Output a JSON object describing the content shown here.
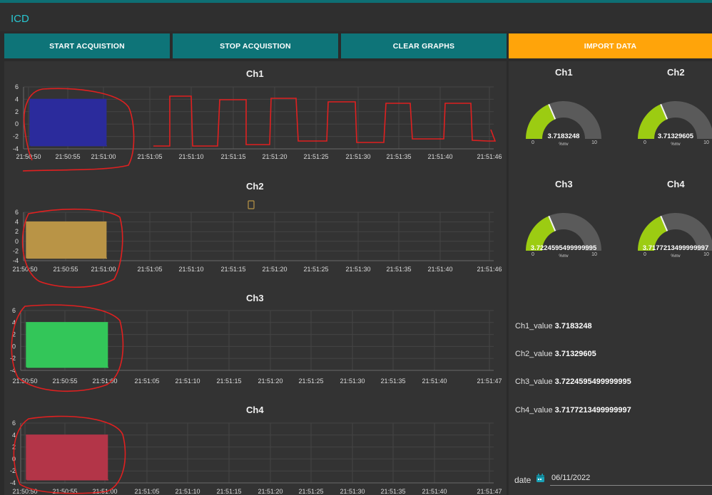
{
  "app": {
    "title": "ICD"
  },
  "toolbar": {
    "start_label": "START ACQUISTION",
    "stop_label": "STOP ACQUISTION",
    "clear_label": "CLEAR GRAPHS",
    "import_label": "IMPORT DATA"
  },
  "chart_data": [
    {
      "type": "line",
      "title": "Ch1",
      "x_ticks": [
        "21:50:50",
        "21:50:55",
        "21:51:00",
        "21:51:05",
        "21:51:10",
        "21:51:15",
        "21:51:20",
        "21:51:25",
        "21:51:30",
        "21:51:35",
        "21:51:40",
        "21:51:46"
      ],
      "y_ticks": [
        "6",
        "4",
        "2",
        "0",
        "-2",
        "-4"
      ],
      "ylim": [
        -4,
        6
      ],
      "series": [
        {
          "color": "#2b2b9c",
          "high": 4,
          "low": -3.5,
          "x_range": [
            "21:50:50",
            "21:51:00"
          ]
        }
      ]
    },
    {
      "type": "line",
      "title": "Ch2",
      "x_ticks": [
        "21:50:50",
        "21:50:55",
        "21:51:00",
        "21:51:05",
        "21:51:10",
        "21:51:15",
        "21:51:20",
        "21:51:25",
        "21:51:30",
        "21:51:35",
        "21:51:40",
        "21:51:46"
      ],
      "y_ticks": [
        "6",
        "4",
        "2",
        "0",
        "-2",
        "-4"
      ],
      "ylim": [
        -4,
        6
      ],
      "series": [
        {
          "color": "#b99446",
          "high": 4,
          "low": -3.5,
          "x_range": [
            "21:50:50",
            "21:51:00"
          ]
        }
      ]
    },
    {
      "type": "line",
      "title": "Ch3",
      "x_ticks": [
        "21:50:50",
        "21:50:55",
        "21:51:00",
        "21:51:05",
        "21:51:10",
        "21:51:15",
        "21:51:20",
        "21:51:25",
        "21:51:30",
        "21:51:35",
        "21:51:40",
        "21:51:47"
      ],
      "y_ticks": [
        "6",
        "4",
        "2",
        "0",
        "-2",
        "-4"
      ],
      "ylim": [
        -4,
        6
      ],
      "series": [
        {
          "color": "#33c659",
          "high": 4,
          "low": -3.5,
          "x_range": [
            "21:50:50",
            "21:51:00"
          ]
        }
      ]
    },
    {
      "type": "line",
      "title": "Ch4",
      "x_ticks": [
        "21:50:50",
        "21:50:55",
        "21:51:00",
        "21:51:05",
        "21:51:10",
        "21:51:15",
        "21:51:20",
        "21:51:25",
        "21:51:30",
        "21:51:35",
        "21:51:40",
        "21:51:47"
      ],
      "y_ticks": [
        "6",
        "4",
        "2",
        "0",
        "-2",
        "-4"
      ],
      "ylim": [
        -4,
        6
      ],
      "series": [
        {
          "color": "#b33548",
          "high": 4,
          "low": -3.5,
          "x_range": [
            "21:50:50",
            "21:51:00"
          ]
        }
      ]
    }
  ],
  "gauges": [
    {
      "title": "Ch1",
      "value": 3.7183248,
      "value_text": "3.7183248",
      "min": "0",
      "max": "10",
      "unit": "%mv"
    },
    {
      "title": "Ch2",
      "value": 3.71329605,
      "value_text": "3.71329605",
      "min": "0",
      "max": "10",
      "unit": "%mv"
    },
    {
      "title": "Ch3",
      "value": 3.7224595499999995,
      "value_text": "3.7224595499999995",
      "min": "0",
      "max": "10",
      "unit": "%mv"
    },
    {
      "title": "Ch4",
      "value": 3.7177213499999997,
      "value_text": "3.7177213499999997",
      "min": "0",
      "max": "10",
      "unit": "%mv"
    }
  ],
  "values": [
    {
      "label": "Ch1_value",
      "value": "3.7183248"
    },
    {
      "label": "Ch2_value",
      "value": "3.71329605"
    },
    {
      "label": "Ch3_value",
      "value": "3.7224595499999995"
    },
    {
      "label": "Ch4_value",
      "value": "3.7177213499999997"
    }
  ],
  "date": {
    "label": "date",
    "value": "06/11/2022"
  },
  "colors": {
    "accent_teal": "#0e7478",
    "import_orange": "#ffa40a",
    "gauge_fill": "#9ccc12",
    "gauge_track": "#5a5a5a",
    "annotation": "#e02020"
  }
}
